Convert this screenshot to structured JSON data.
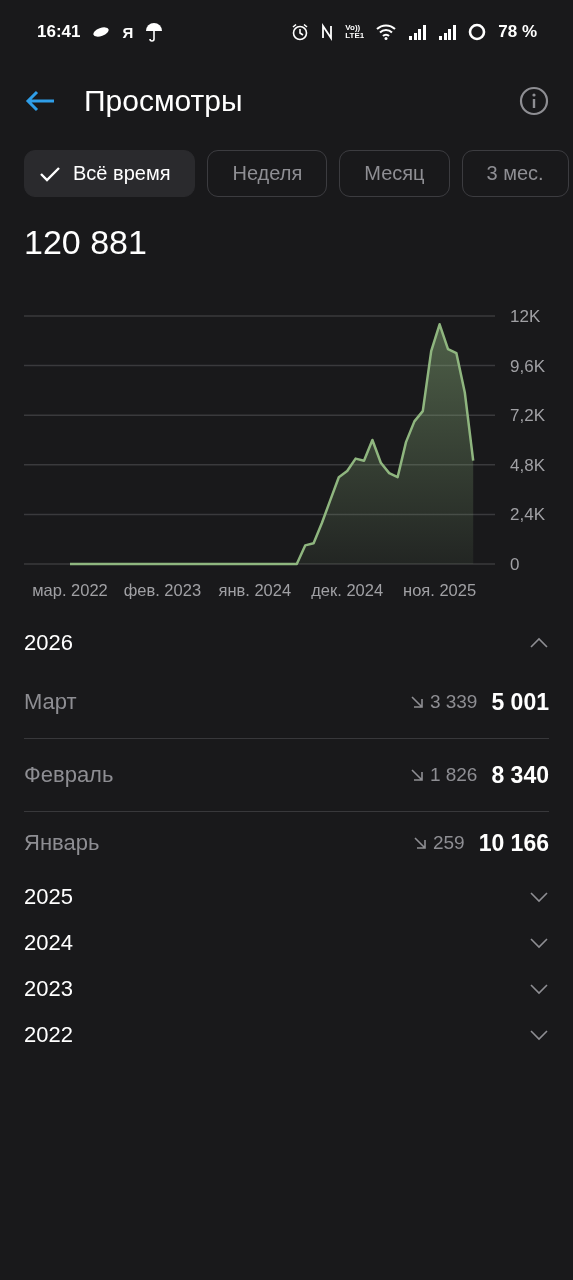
{
  "status_bar": {
    "time": "16:41",
    "carrier_letter": "Я",
    "volte_top": "Vo))",
    "volte_bottom": "LTE1",
    "battery": "78 %"
  },
  "header": {
    "title": "Просмотры"
  },
  "periods": [
    {
      "label": "Всё время",
      "selected": true
    },
    {
      "label": "Неделя",
      "selected": false
    },
    {
      "label": "Месяц",
      "selected": false
    },
    {
      "label": "3 мес.",
      "selected": false
    }
  ],
  "total": "120 881",
  "chart_data": {
    "type": "area",
    "categories": [
      "мар. 2022",
      null,
      null,
      null,
      null,
      null,
      null,
      null,
      null,
      null,
      null,
      "фев. 2023",
      null,
      null,
      null,
      null,
      null,
      null,
      null,
      null,
      null,
      null,
      "янв. 2024",
      null,
      null,
      null,
      null,
      null,
      null,
      null,
      null,
      null,
      null,
      "дек. 2024",
      null,
      null,
      null,
      null,
      null,
      null,
      null,
      null,
      null,
      null,
      "ноя. 2025",
      null,
      null,
      null,
      null
    ],
    "series": [
      {
        "color": "#8fb67f",
        "values": [
          0,
          0,
          0,
          0,
          0,
          0,
          0,
          0,
          0,
          0,
          0,
          0,
          0,
          0,
          0,
          0,
          0,
          0,
          0,
          0,
          0,
          0,
          0,
          0,
          0,
          0,
          0,
          0,
          900,
          1000,
          2000,
          3100,
          4200,
          4500,
          5100,
          5000,
          6000,
          4900,
          4400,
          4200,
          5900,
          6900,
          7400,
          10300,
          11600,
          10400,
          10200,
          8300,
          5000
        ]
      }
    ],
    "grid": true,
    "ylim": [
      0,
      12000
    ],
    "yticks": [
      {
        "value": 0,
        "label": "0"
      },
      {
        "value": 2400,
        "label": "2,4K"
      },
      {
        "value": 4800,
        "label": "4,8K"
      },
      {
        "value": 7200,
        "label": "7,2K"
      },
      {
        "value": 9600,
        "label": "9,6K"
      },
      {
        "value": 12000,
        "label": "12K"
      }
    ]
  },
  "years": [
    {
      "label": "2026",
      "expanded": true,
      "months": [
        {
          "name": "Март",
          "delta": "3 339",
          "total": "5 001"
        },
        {
          "name": "Февраль",
          "delta": "1 826",
          "total": "8 340"
        },
        {
          "name": "Январь",
          "delta": "259",
          "total": "10 166"
        }
      ]
    },
    {
      "label": "2025",
      "expanded": false
    },
    {
      "label": "2024",
      "expanded": false
    },
    {
      "label": "2023",
      "expanded": false
    },
    {
      "label": "2022",
      "expanded": false
    }
  ]
}
